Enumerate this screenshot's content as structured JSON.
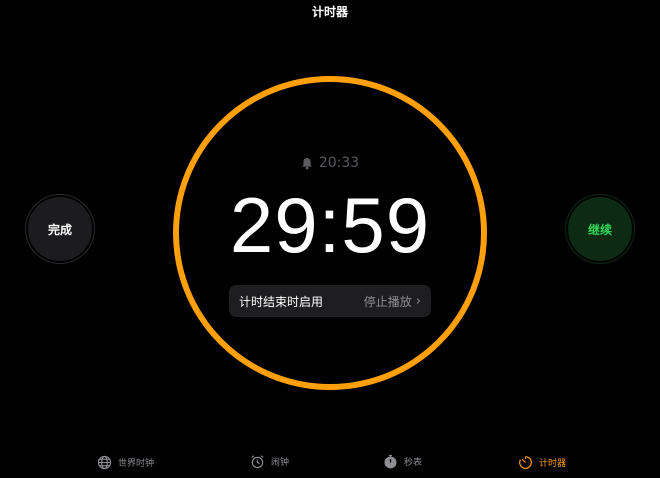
{
  "header": {
    "title": "计时器"
  },
  "timer": {
    "alarm_time": "20:33",
    "remaining": "29:59",
    "ring_color": "#ff9f0a"
  },
  "option": {
    "label": "计时结束时启用",
    "value": "停止播放",
    "chevron": "›"
  },
  "buttons": {
    "done": "完成",
    "continue": "继续"
  },
  "tabs": [
    {
      "label": "世界时钟",
      "icon": "globe-icon",
      "active": false
    },
    {
      "label": "闹钟",
      "icon": "alarm-clock-icon",
      "active": false
    },
    {
      "label": "秒表",
      "icon": "stopwatch-icon",
      "active": false
    },
    {
      "label": "计时器",
      "icon": "timer-icon",
      "active": true
    }
  ],
  "colors": {
    "accent": "#ff9f0a",
    "continue_text": "#30d158",
    "continue_bg": "#0d2a12",
    "done_bg": "#1c1c1e"
  }
}
